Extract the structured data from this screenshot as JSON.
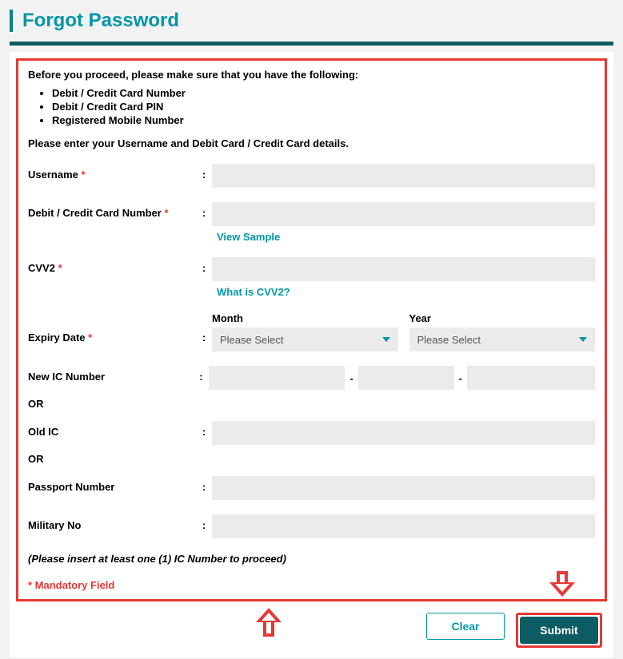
{
  "header": {
    "title": "Forgot Password"
  },
  "intro": "Before you proceed, please make sure that you have the following:",
  "requirements": [
    "Debit / Credit Card Number",
    "Debit / Credit Card PIN",
    "Registered Mobile Number"
  ],
  "instruction": "Please enter your Username and Debit Card / Credit Card details.",
  "labels": {
    "username": "Username",
    "card_number": "Debit / Credit Card Number",
    "cvv2": "CVV2",
    "expiry": "Expiry Date",
    "month": "Month",
    "year": "Year",
    "new_ic": "New IC Number",
    "old_ic": "Old IC",
    "passport": "Passport Number",
    "military": "Military No",
    "or": "OR"
  },
  "links": {
    "view_sample": "View Sample",
    "what_is_cvv2": "What is CVV2?"
  },
  "select_placeholder": "Please Select",
  "values": {
    "username": "",
    "card_number": "",
    "cvv2": "",
    "month": "",
    "year": "",
    "ic1": "",
    "ic2": "",
    "ic3": "",
    "old_ic": "",
    "passport": "",
    "military": ""
  },
  "note": "(Please insert at least one (1) IC Number to proceed)",
  "mandatory_note": "* Mandatory Field",
  "buttons": {
    "clear": "Clear",
    "submit": "Submit"
  },
  "required_mark": "*"
}
